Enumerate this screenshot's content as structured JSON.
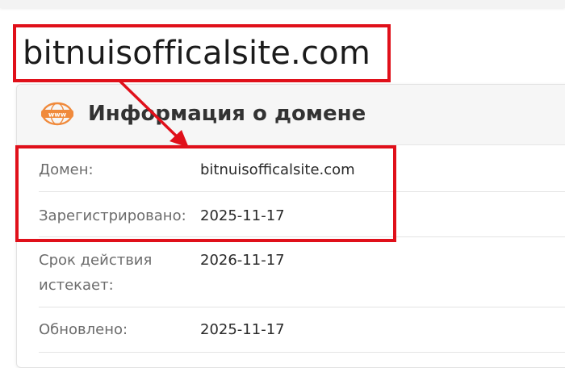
{
  "domain_title": "bitnuisofficalsite.com",
  "card": {
    "icon": "www-icon",
    "title": "Информация о домене"
  },
  "rows": [
    {
      "label": "Домен:",
      "value": "bitnuisofficalsite.com"
    },
    {
      "label": "Зарегистрировано:",
      "value": "2025-11-17"
    },
    {
      "label": "Срок действия истекает:",
      "value": "2026-11-17"
    },
    {
      "label": "Обновлено:",
      "value": "2025-11-17"
    }
  ],
  "colors": {
    "highlight": "#e0101a",
    "icon_orange": "#f08a3c"
  }
}
